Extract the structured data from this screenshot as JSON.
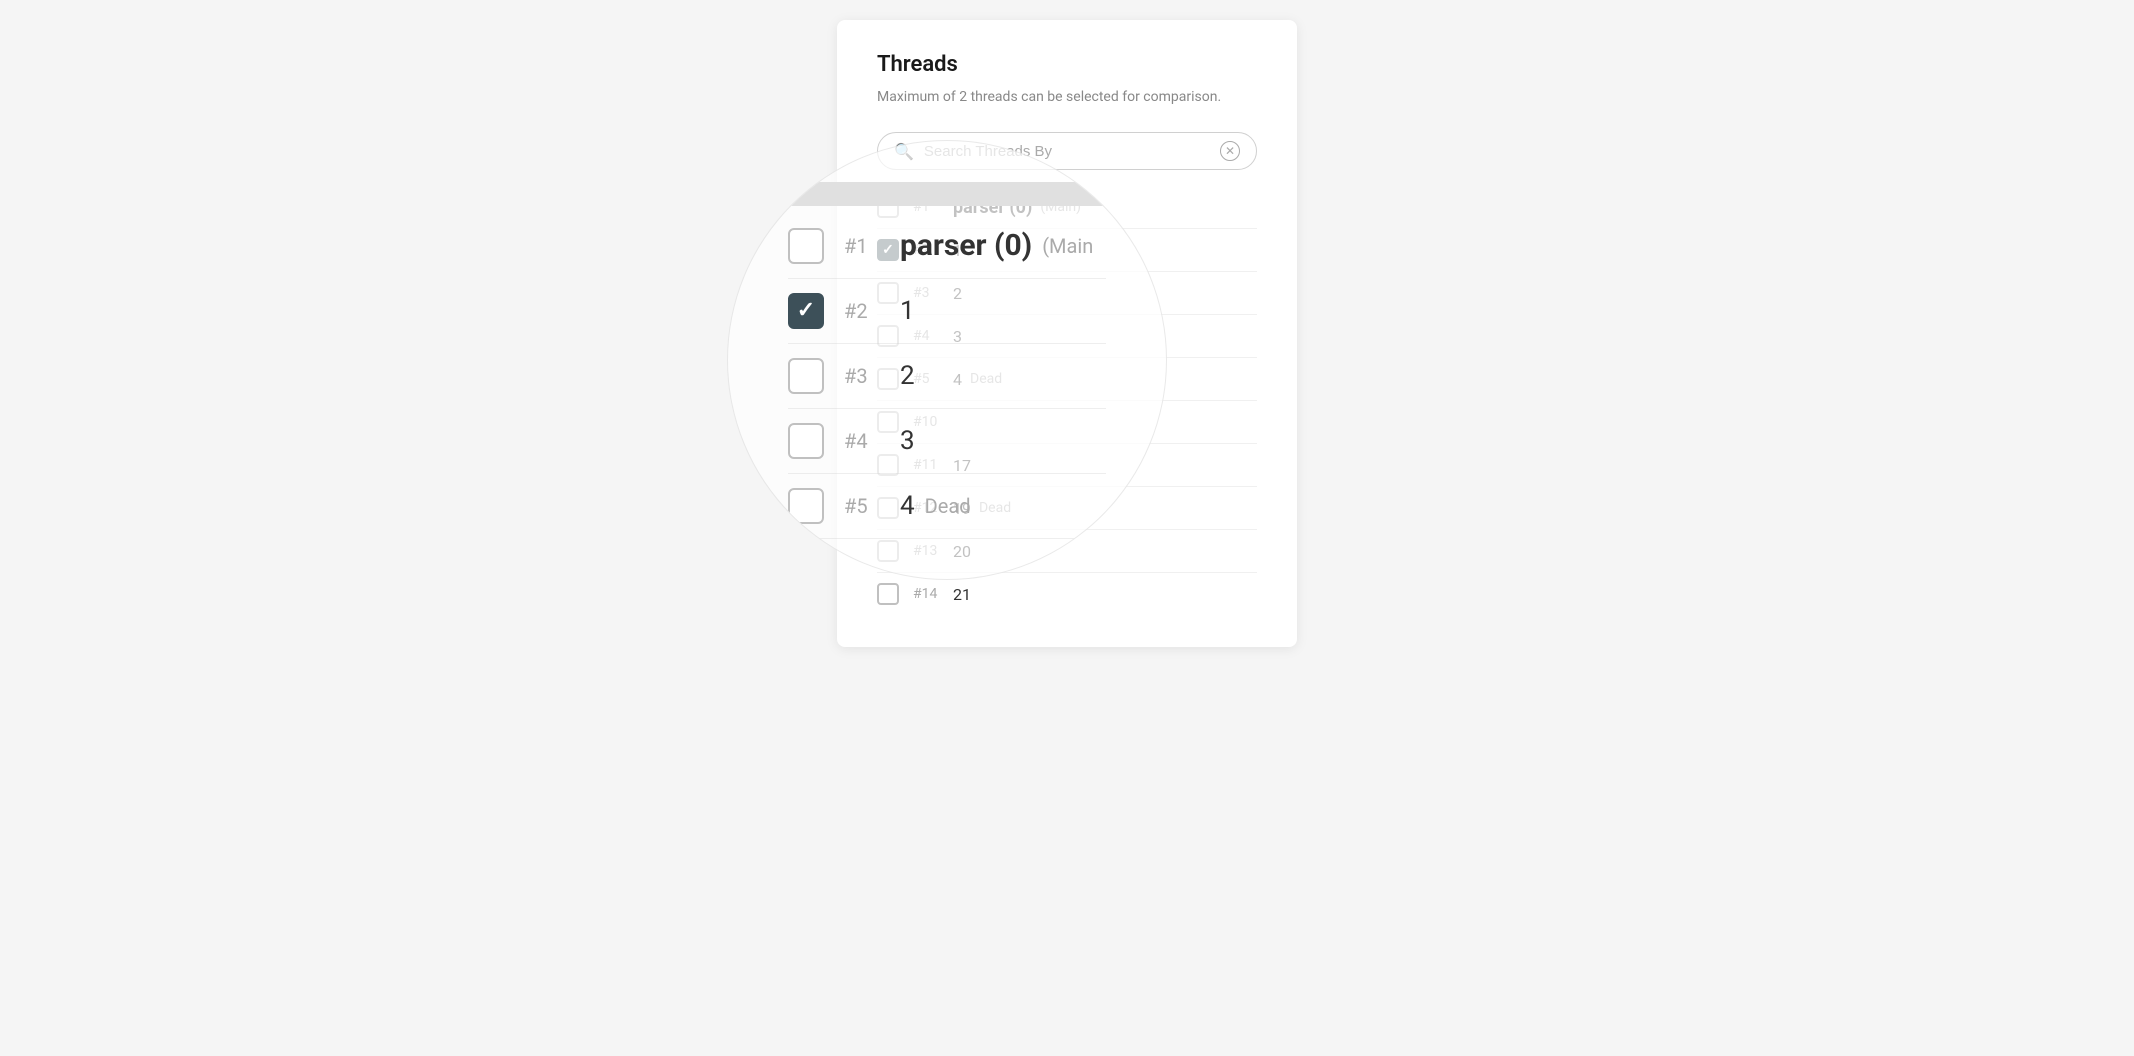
{
  "panel": {
    "title": "Threads",
    "subtitle": "Maximum of 2 threads can be selected for comparison.",
    "search": {
      "placeholder": "Search Threads By",
      "value": "Search Threads By"
    },
    "threads": [
      {
        "id": 1,
        "num": "#1",
        "name": "parser (0)",
        "badge": "(Main)",
        "checked": false
      },
      {
        "id": 2,
        "num": "#2",
        "name": "1",
        "badge": "",
        "checked": true
      },
      {
        "id": 3,
        "num": "#3",
        "name": "2",
        "badge": "",
        "checked": false
      },
      {
        "id": 4,
        "num": "#4",
        "name": "3",
        "badge": "",
        "checked": false
      },
      {
        "id": 5,
        "num": "#5",
        "name": "4",
        "badge": "Dead",
        "checked": false
      },
      {
        "id": 10,
        "num": "#10",
        "name": "",
        "badge": "",
        "checked": false
      },
      {
        "id": 11,
        "num": "#11",
        "name": "17",
        "badge": "",
        "checked": false
      },
      {
        "id": 12,
        "num": "#12",
        "name": "19",
        "badge": "Dead",
        "checked": false
      },
      {
        "id": 13,
        "num": "#13",
        "name": "20",
        "badge": "",
        "checked": false
      },
      {
        "id": 14,
        "num": "#14",
        "name": "21",
        "badge": "",
        "checked": false
      }
    ]
  },
  "magnifier": {
    "items": [
      {
        "num": "#1",
        "name": "parser (0)",
        "badge": "(Main",
        "checked": false,
        "bold": true
      },
      {
        "num": "#2",
        "name": "1",
        "badge": "",
        "checked": true,
        "bold": false
      },
      {
        "num": "#3",
        "name": "2",
        "badge": "",
        "checked": false,
        "bold": false
      },
      {
        "num": "#4",
        "name": "3",
        "badge": "",
        "checked": false,
        "bold": false
      },
      {
        "num": "#5",
        "name": "4",
        "badge": "Dead",
        "checked": false,
        "bold": false
      }
    ]
  }
}
